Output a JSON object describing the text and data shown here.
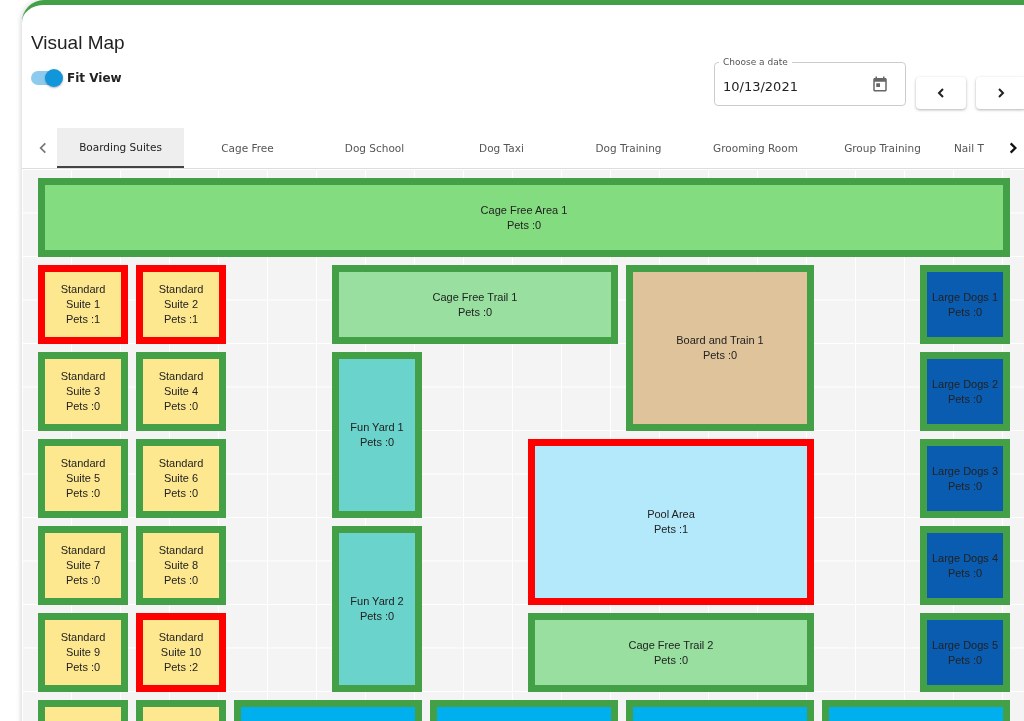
{
  "title": "Visual Map",
  "fit_view": {
    "label": "Fit View",
    "on": true
  },
  "date_field": {
    "label": "Choose a date",
    "value": "10/13/2021"
  },
  "tabs": [
    {
      "label": "Boarding Suites",
      "selected": true
    },
    {
      "label": "Cage Free",
      "selected": false
    },
    {
      "label": "Dog School",
      "selected": false
    },
    {
      "label": "Dog Taxi",
      "selected": false
    },
    {
      "label": "Dog Training",
      "selected": false
    },
    {
      "label": "Grooming Room",
      "selected": false
    },
    {
      "label": "Group Training",
      "selected": false
    },
    {
      "label": "Nail T",
      "selected": false
    }
  ],
  "rooms": [
    {
      "name": "Cage Free Area 1",
      "pets": "Pets :0",
      "occupied": false,
      "color": "#83dc7f"
    },
    {
      "name": "Standard Suite 1",
      "pets": "Pets :1",
      "occupied": true,
      "color": "#fee88f"
    },
    {
      "name": "Standard Suite 2",
      "pets": "Pets :1",
      "occupied": true,
      "color": "#fee88f"
    },
    {
      "name": "Cage Free Trail 1",
      "pets": "Pets :0",
      "occupied": false,
      "color": "#98dfa0"
    },
    {
      "name": "Board and Train 1",
      "pets": "Pets :0",
      "occupied": false,
      "color": "#dfc49b"
    },
    {
      "name": "Large Dogs 1",
      "pets": "Pets :0",
      "occupied": false,
      "color": "#0a5cb0"
    },
    {
      "name": "Standard Suite 3",
      "pets": "Pets :0",
      "occupied": false,
      "color": "#fee88f"
    },
    {
      "name": "Standard Suite 4",
      "pets": "Pets :0",
      "occupied": false,
      "color": "#fee88f"
    },
    {
      "name": "Fun Yard 1",
      "pets": "Pets :0",
      "occupied": false,
      "color": "#6ad3cc"
    },
    {
      "name": "Large Dogs 2",
      "pets": "Pets :0",
      "occupied": false,
      "color": "#0a5cb0"
    },
    {
      "name": "Standard Suite 5",
      "pets": "Pets :0",
      "occupied": false,
      "color": "#fee88f"
    },
    {
      "name": "Standard Suite 6",
      "pets": "Pets :0",
      "occupied": false,
      "color": "#fee88f"
    },
    {
      "name": "Pool Area",
      "pets": "Pets :1",
      "occupied": true,
      "color": "#b4e9fb"
    },
    {
      "name": "Large Dogs 3",
      "pets": "Pets :0",
      "occupied": false,
      "color": "#0a5cb0"
    },
    {
      "name": "Standard Suite 7",
      "pets": "Pets :0",
      "occupied": false,
      "color": "#fee88f"
    },
    {
      "name": "Standard Suite 8",
      "pets": "Pets :0",
      "occupied": false,
      "color": "#fee88f"
    },
    {
      "name": "Fun Yard 2",
      "pets": "Pets :0",
      "occupied": false,
      "color": "#6ad3cc"
    },
    {
      "name": "Large Dogs 4",
      "pets": "Pets :0",
      "occupied": false,
      "color": "#0a5cb0"
    },
    {
      "name": "Standard Suite 9",
      "pets": "Pets :0",
      "occupied": false,
      "color": "#fee88f"
    },
    {
      "name": "Standard Suite 10",
      "pets": "Pets :2",
      "occupied": true,
      "color": "#fee88f"
    },
    {
      "name": "Cage Free Trail 2",
      "pets": "Pets :0",
      "occupied": false,
      "color": "#98dfa0"
    },
    {
      "name": "Large Dogs 5",
      "pets": "Pets :0",
      "occupied": false,
      "color": "#0a5cb0"
    },
    {
      "occupied": false,
      "color": "#fee88f"
    },
    {
      "occupied": false,
      "color": "#fee88f"
    },
    {
      "occupied": false,
      "color": "#00b0ee"
    },
    {
      "occupied": false,
      "color": "#00b0ee"
    },
    {
      "occupied": false,
      "color": "#00b0ee"
    },
    {
      "occupied": false,
      "color": "#00b0ee"
    }
  ]
}
